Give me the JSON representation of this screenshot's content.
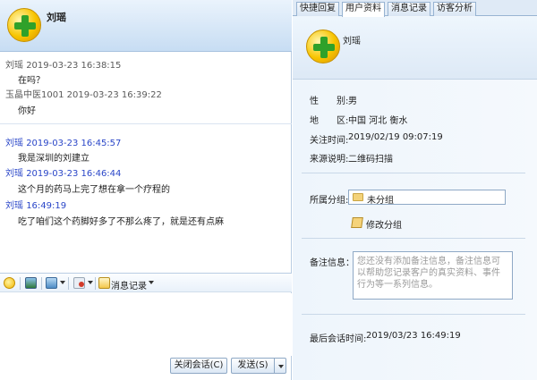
{
  "contact": {
    "name": "刘瑶"
  },
  "messages": [
    {
      "sender": "刘瑶",
      "time": "2019-03-23 16:38:15",
      "text": "在吗？",
      "style": "gray"
    },
    {
      "sender": "玉晶中医1001",
      "time": "2019-03-23 16:39:22",
      "text": "你好",
      "style": "gray"
    },
    {
      "sender": "刘瑶",
      "time": "2019-03-23 16:45:57",
      "text": "我是深圳的刘建立",
      "style": "blue"
    },
    {
      "sender": "刘瑶",
      "time": "2019-03-23 16:46:44",
      "text": "这个月的药马上完了想在拿一个疗程的",
      "style": "blue"
    },
    {
      "sender": "刘瑶",
      "time": " 16:49:19",
      "text": "吃了咱们这个药脚好多了不那么疼了，就是还有点麻",
      "style": "blue"
    }
  ],
  "toolbar": {
    "history_label": "消息记录"
  },
  "buttons": {
    "close": "关闭会话(C)",
    "send": "发送(S)"
  },
  "tabs": [
    {
      "label": "快捷回复",
      "active": false
    },
    {
      "label": "用户资料",
      "active": true
    },
    {
      "label": "消息记录",
      "active": false
    },
    {
      "label": "访客分析",
      "active": false
    }
  ],
  "profile": {
    "name": "刘瑶",
    "gender_label": "性　　别:",
    "gender": "男",
    "region_label": "地　　区:",
    "region": "中国  河北  衡水",
    "follow_label": "关注时间:",
    "follow_time": "2019/02/19 09:07:19",
    "source_label": "来源说明:",
    "source": "二维码扫描",
    "group_label": "所属分组:",
    "group": "未分组",
    "edit_group": "修改分组",
    "note_label": "备注信息：",
    "note_placeholder": "您还没有添加备注信息，备注信息可以帮助您记录客户的真实资料、事件行为等一系列信息。",
    "last_session_label": "最后会话时间:",
    "last_session": "2019/03/23 16:49:19"
  },
  "colors": {
    "accent_blue": "#2a46c8",
    "header_bg": "#c7ddf3",
    "avatar_green": "#2fa12a",
    "avatar_yellow": "#f7c400"
  }
}
